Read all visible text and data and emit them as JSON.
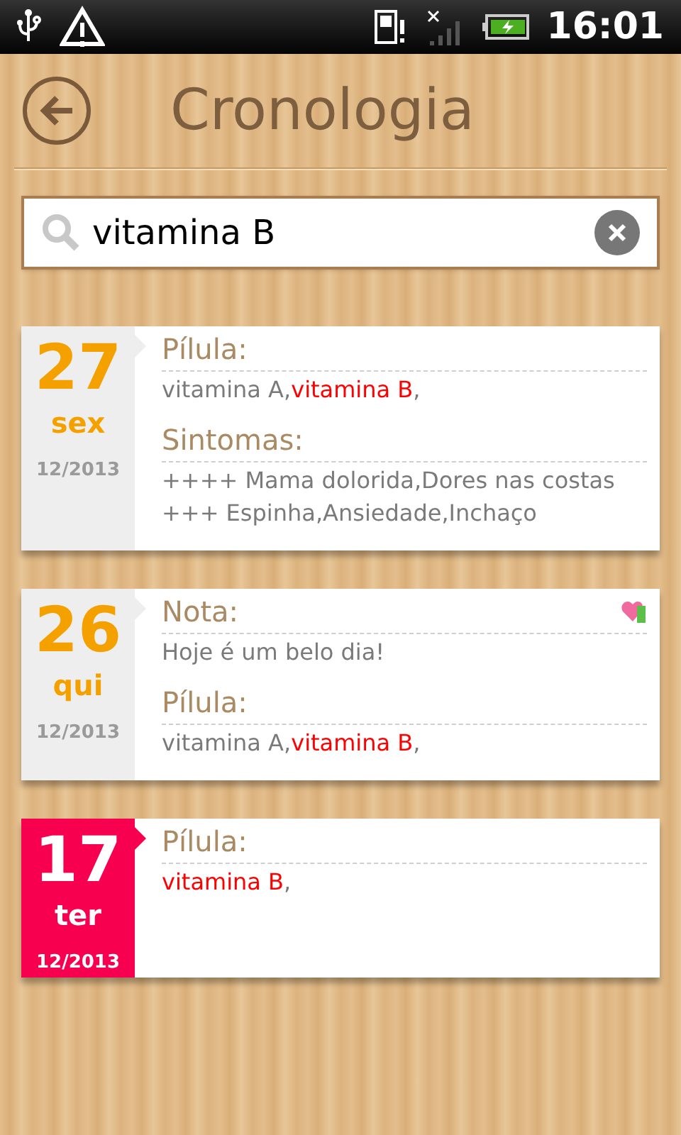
{
  "status_bar": {
    "time": "16:01"
  },
  "header": {
    "title": "Cronologia"
  },
  "search": {
    "value": "vitamina B"
  },
  "entries": [
    {
      "day": "27",
      "weekday": "sex",
      "month": "12/2013",
      "highlighted": false,
      "sections": [
        {
          "label": "Pílula:",
          "lines": [
            [
              {
                "text": "vitamina A,",
                "match": false
              },
              {
                "text": "vitamina B",
                "match": true
              },
              {
                "text": ",",
                "match": false
              }
            ]
          ]
        },
        {
          "label": "Sintomas:",
          "lines": [
            [
              {
                "text": "++++ Mama dolorida,Dores nas costas",
                "match": false
              }
            ],
            [
              {
                "text": "+++ Espinha,Ansiedade,Inchaço",
                "match": false
              }
            ]
          ]
        }
      ]
    },
    {
      "day": "26",
      "weekday": "qui",
      "month": "12/2013",
      "highlighted": false,
      "sections": [
        {
          "label": "Nota:",
          "heart_icon": true,
          "lines": [
            [
              {
                "text": "Hoje é um belo dia!",
                "match": false
              }
            ]
          ]
        },
        {
          "label": "Pílula:",
          "lines": [
            [
              {
                "text": "vitamina A,",
                "match": false
              },
              {
                "text": "vitamina B",
                "match": true
              },
              {
                "text": ",",
                "match": false
              }
            ]
          ]
        }
      ]
    },
    {
      "day": "17",
      "weekday": "ter",
      "month": "12/2013",
      "highlighted": true,
      "sections": [
        {
          "label": "Pílula:",
          "lines": [
            [
              {
                "text": "vitamina B",
                "match": true
              },
              {
                "text": ",",
                "match": false
              }
            ]
          ]
        }
      ]
    }
  ]
}
